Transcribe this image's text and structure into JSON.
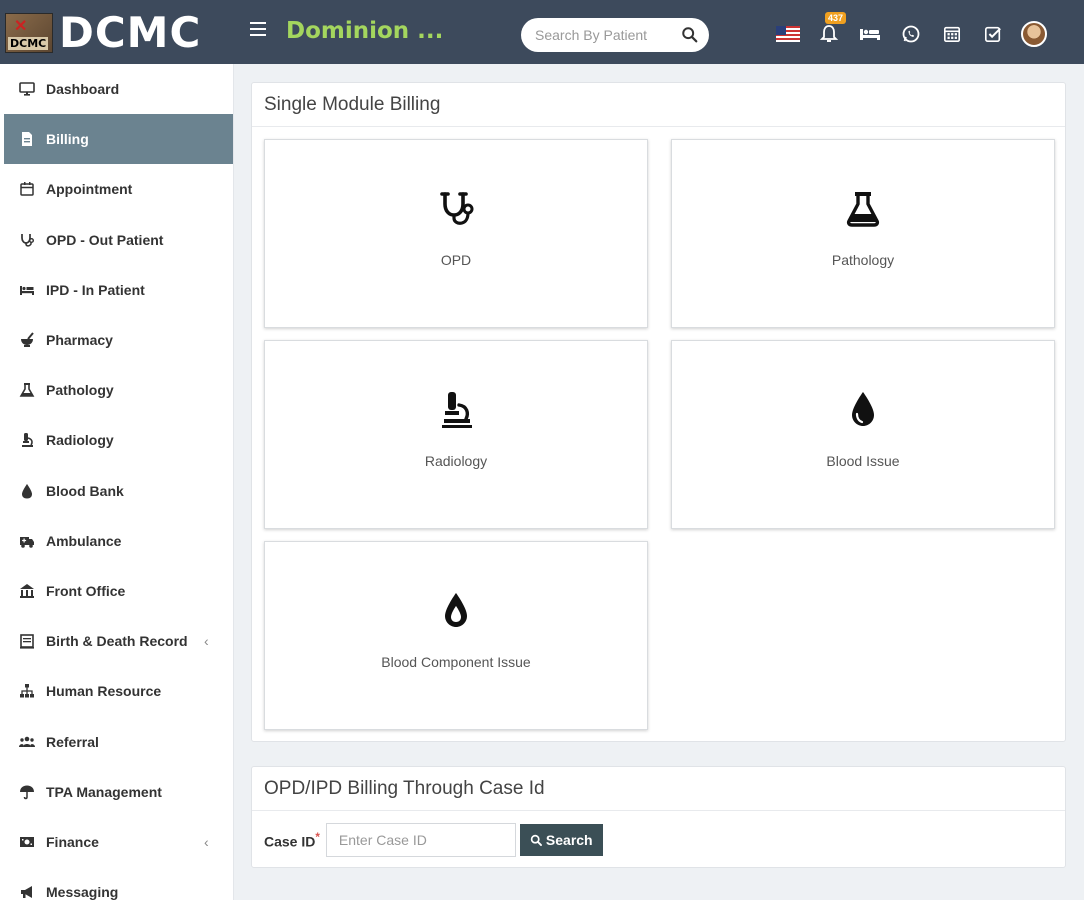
{
  "header": {
    "logo_text": "DCMC",
    "logo_tag": "DCMC",
    "hospital_name": "Dominion ...",
    "search_placeholder": "Search By Patient",
    "notification_count": "437"
  },
  "sidebar": {
    "items": [
      {
        "label": "Dashboard",
        "icon": "monitor-icon"
      },
      {
        "label": "Billing",
        "icon": "file-icon",
        "active": true
      },
      {
        "label": "Appointment",
        "icon": "calendar-icon"
      },
      {
        "label": "OPD - Out Patient",
        "icon": "stethoscope-icon"
      },
      {
        "label": "IPD - In Patient",
        "icon": "bed-icon"
      },
      {
        "label": "Pharmacy",
        "icon": "mortar-icon"
      },
      {
        "label": "Pathology",
        "icon": "flask-icon"
      },
      {
        "label": "Radiology",
        "icon": "microscope-icon"
      },
      {
        "label": "Blood Bank",
        "icon": "drop-icon"
      },
      {
        "label": "Ambulance",
        "icon": "ambulance-icon"
      },
      {
        "label": "Front Office",
        "icon": "building-icon"
      },
      {
        "label": "Birth & Death Record",
        "icon": "book-icon",
        "caret": "‹"
      },
      {
        "label": "Human Resource",
        "icon": "sitemap-icon"
      },
      {
        "label": "Referral",
        "icon": "users-icon"
      },
      {
        "label": "TPA Management",
        "icon": "umbrella-icon"
      },
      {
        "label": "Finance",
        "icon": "money-icon",
        "caret": "‹"
      },
      {
        "label": "Messaging",
        "icon": "bullhorn-icon"
      }
    ]
  },
  "billing_panel": {
    "title": "Single Module Billing",
    "tiles": [
      {
        "label": "OPD",
        "icon": "stethoscope-icon"
      },
      {
        "label": "Pathology",
        "icon": "flask-icon"
      },
      {
        "label": "Radiology",
        "icon": "microscope-icon"
      },
      {
        "label": "Blood Issue",
        "icon": "drop-icon"
      },
      {
        "label": "Blood Component Issue",
        "icon": "drop-outline-icon"
      }
    ]
  },
  "case_panel": {
    "title": "OPD/IPD Billing Through Case Id",
    "field_label": "Case ID",
    "required_mark": "*",
    "input_placeholder": "Enter Case ID",
    "input_value": "",
    "button_label": "Search"
  },
  "colors": {
    "header_bg": "#3d4a5c",
    "hospital_name": "#a4d65e",
    "active_nav": "#6b8390",
    "search_button": "#3b4f56",
    "badge": "#f0a020"
  }
}
